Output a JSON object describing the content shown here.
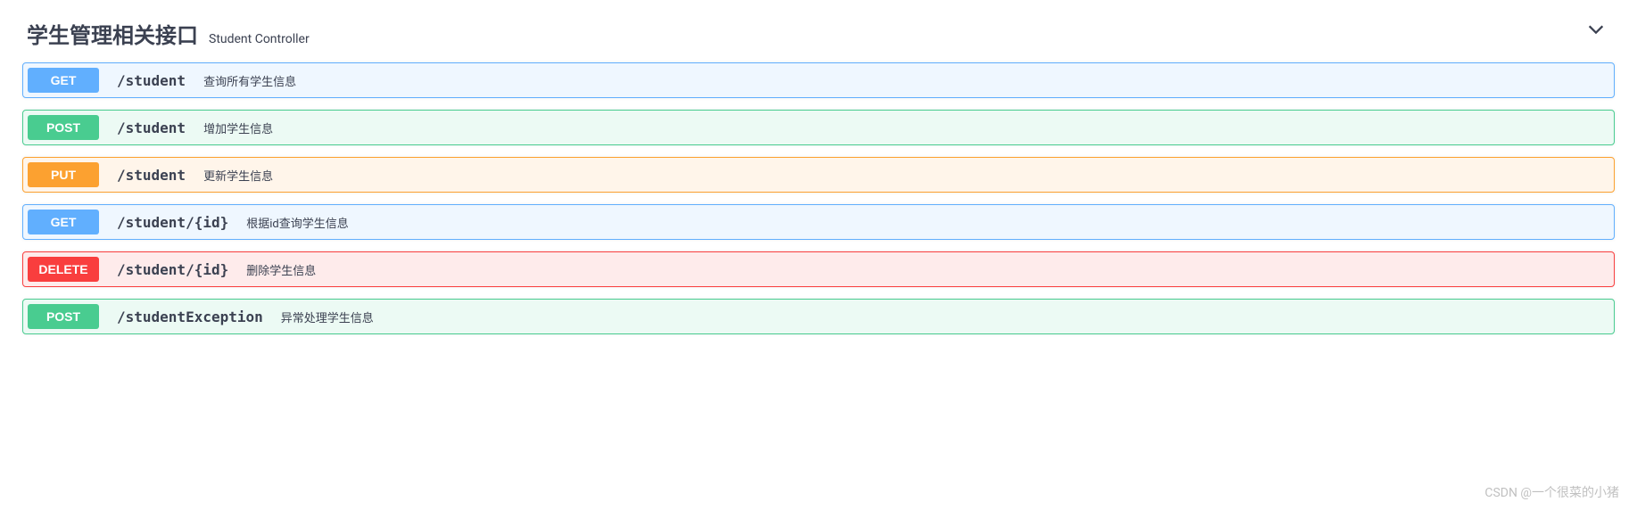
{
  "header": {
    "title": "学生管理相关接口",
    "subtitle": "Student Controller"
  },
  "operations": [
    {
      "method": "GET",
      "method_class": "opblock-get",
      "path": "/student",
      "description": "查询所有学生信息"
    },
    {
      "method": "POST",
      "method_class": "opblock-post",
      "path": "/student",
      "description": "增加学生信息"
    },
    {
      "method": "PUT",
      "method_class": "opblock-put",
      "path": "/student",
      "description": "更新学生信息"
    },
    {
      "method": "GET",
      "method_class": "opblock-get",
      "path": "/student/{id}",
      "description": "根据id查询学生信息"
    },
    {
      "method": "DELETE",
      "method_class": "opblock-delete",
      "path": "/student/{id}",
      "description": "删除学生信息"
    },
    {
      "method": "POST",
      "method_class": "opblock-post",
      "path": "/studentException",
      "description": "异常处理学生信息"
    }
  ],
  "watermark": "CSDN @一个很菜的小猪"
}
